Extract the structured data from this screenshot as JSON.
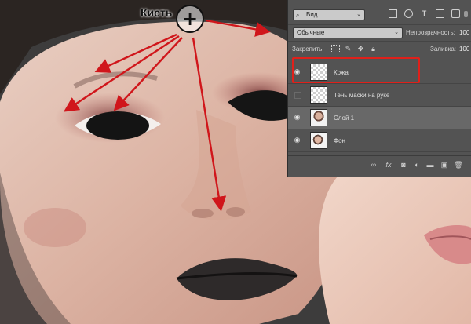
{
  "annotation": {
    "brush_label": "Кисть",
    "arrow_color": "#d0161b",
    "highlight_color": "#e0201a"
  },
  "layers_panel": {
    "filter": {
      "label": "Вид"
    },
    "filter_icons": [
      "image-filter-icon",
      "adjustment-filter-icon",
      "type-filter-icon",
      "shape-filter-icon",
      "smart-object-filter-icon"
    ],
    "blend_mode": "Обычные",
    "opacity_label": "Непрозрачность:",
    "opacity_value": "100",
    "lock_label": "Закрепить:",
    "lock_icons": [
      "lock-transparency-icon",
      "lock-pixels-icon",
      "lock-position-icon",
      "lock-all-icon"
    ],
    "fill_label": "Заливка:",
    "fill_value": "100",
    "layers": [
      {
        "name": "Кожа",
        "visible": true,
        "thumbnail": "transparent",
        "highlighted": true
      },
      {
        "name": "Тень маски на руке",
        "visible": false,
        "thumbnail": "transparent"
      },
      {
        "name": "Слой 1",
        "visible": true,
        "thumbnail": "photo",
        "selected": true
      },
      {
        "name": "Фон",
        "visible": true,
        "thumbnail": "photo"
      }
    ],
    "bottom_icons": [
      "link-layers-icon",
      "fx-icon",
      "add-mask-icon",
      "adjustment-layer-icon",
      "new-group-icon",
      "new-layer-icon",
      "trash-icon"
    ]
  }
}
